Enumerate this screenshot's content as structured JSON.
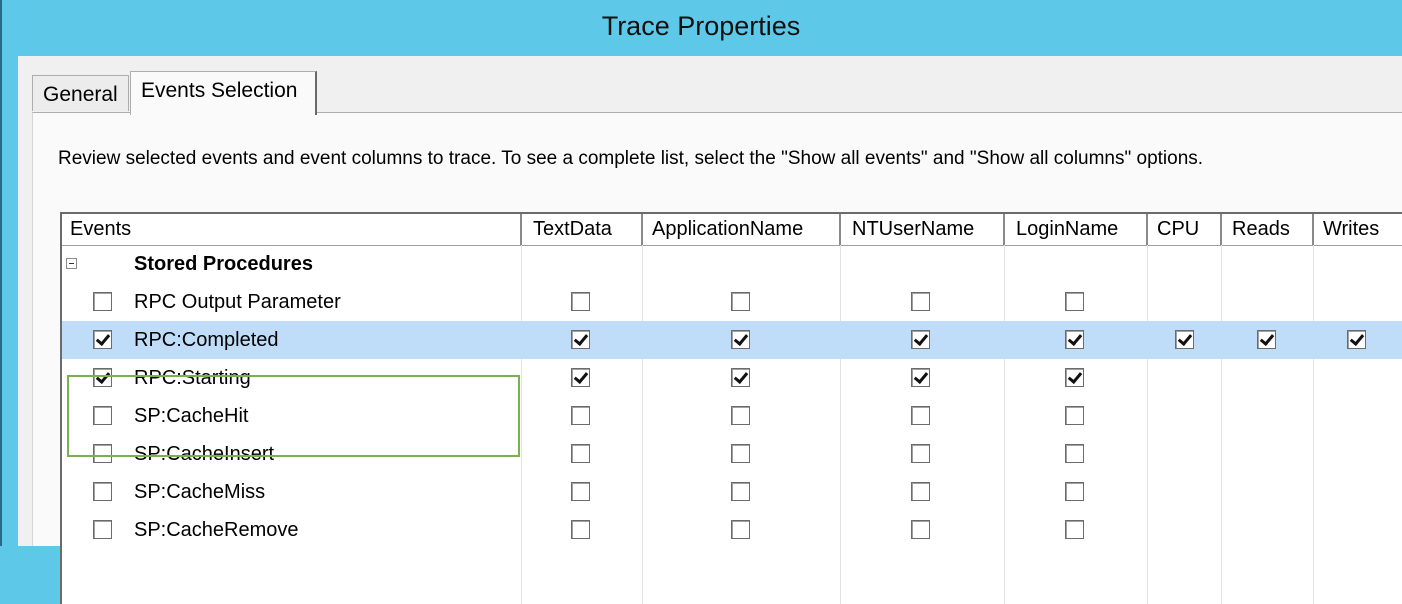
{
  "window": {
    "title": "Trace Properties"
  },
  "tabs": [
    {
      "label": "General",
      "active": false
    },
    {
      "label": "Events Selection",
      "active": true
    }
  ],
  "instructions": "Review selected events and event columns to trace. To see a complete list, select the \"Show all events\" and \"Show all columns\" options.",
  "grid": {
    "columns": [
      "Events",
      "TextData",
      "ApplicationName",
      "NTUserName",
      "LoginName",
      "CPU",
      "Reads",
      "Writes"
    ],
    "category": {
      "name": "Stored Procedures",
      "expanded": true
    },
    "rows": [
      {
        "name": "RPC Output Parameter",
        "event": false,
        "textdata": false,
        "appname": false,
        "ntuser": false,
        "login": false,
        "selected": false
      },
      {
        "name": "RPC:Completed",
        "event": true,
        "textdata": true,
        "appname": true,
        "ntuser": true,
        "login": true,
        "cpu": true,
        "reads": true,
        "writes": true,
        "selected": true
      },
      {
        "name": "RPC:Starting",
        "event": true,
        "textdata": true,
        "appname": true,
        "ntuser": true,
        "login": true,
        "selected": false
      },
      {
        "name": "SP:CacheHit",
        "event": false,
        "textdata": false,
        "appname": false,
        "ntuser": false,
        "login": false,
        "selected": false
      },
      {
        "name": "SP:CacheInsert",
        "event": false,
        "textdata": false,
        "appname": false,
        "ntuser": false,
        "login": false,
        "selected": false
      },
      {
        "name": "SP:CacheMiss",
        "event": false,
        "textdata": false,
        "appname": false,
        "ntuser": false,
        "login": false,
        "selected": false
      },
      {
        "name": "SP:CacheRemove",
        "event": false,
        "textdata": false,
        "appname": false,
        "ntuser": false,
        "login": false,
        "selected": false
      }
    ]
  },
  "colors": {
    "titlebar": "#5ec8e9",
    "selection": "#bfdcf8",
    "highlight_box": "#7ab050"
  }
}
